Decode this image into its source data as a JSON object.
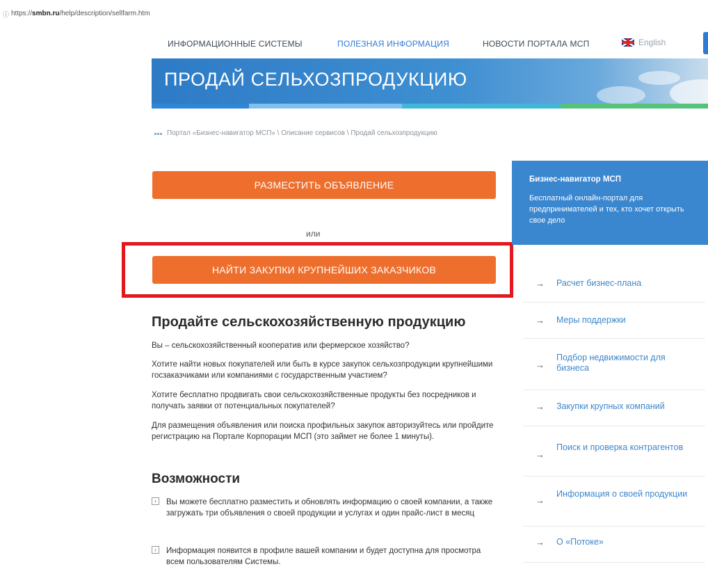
{
  "browser": {
    "url_domain": "smbn.ru",
    "url_prefix": "https://",
    "url_path": "/help/description/sellfarm.htm"
  },
  "nav": {
    "items": [
      "ИНФОРМАЦИОННЫЕ СИСТЕМЫ",
      "ПОЛЕЗНАЯ ИНФОРМАЦИЯ",
      "НОВОСТИ ПОРТАЛА МСП"
    ],
    "active_index": 1,
    "language": "English"
  },
  "banner": {
    "title": "ПРОДАЙ СЕЛЬХОЗПРОДУКЦИЮ"
  },
  "breadcrumb": "Портал «Бизнес-навигатор МСП» \\ Описание сервисов \\ Продай сельхозпродукцию",
  "actions": {
    "post_ad": "РАЗМЕСТИТЬ ОБЪЯВЛЕНИЕ",
    "or": "или",
    "find_purchases": "НАЙТИ ЗАКУПКИ КРУПНЕЙШИХ ЗАКАЗЧИКОВ"
  },
  "content": {
    "heading": "Продайте сельскохозяйственную продукцию",
    "paragraphs": [
      "Вы – сельскохозяйственный кооператив или фермерское хозяйство?",
      "Хотите найти новых покупателей или быть в курсе закупок сельхозпродукции крупнейшими госзаказчиками или компаниями с государственным участием?",
      "Хотите бесплатно продвигать свои сельскохозяйственные продукты без посредников и получать заявки от потенциальных покупателей?",
      "Для размещения объявления или поиска профильных закупок авторизуйтесь или пройдите регистрацию на Портале Корпорации МСП (это займет не более 1 минуты)."
    ],
    "features_heading": "Возможности",
    "features": [
      "Вы можете бесплатно разместить и обновлять информацию о своей компании, а также загружать три объявления о своей продукции и услугах и один прайс-лист в месяц",
      "Информация появится в профиле вашей компании и будет доступна для просмотра всем пользователям Системы."
    ]
  },
  "sidebar": {
    "info_title": "Бизнес-навигатор МСП",
    "info_text": "Бесплатный онлайн-портал для предпринимателей и тех, кто хочет открыть свое дело",
    "menu": [
      "Расчет бизнес-плана",
      "Меры поддержки",
      "Подбор недвижимости для бизнеса",
      "Закупки крупных компаний",
      "Поиск и проверка контрагентов",
      "Информация о своей продукции",
      "О «Потоке»"
    ]
  },
  "colors": {
    "accent_blue": "#2e7bd3",
    "button_orange": "#ee6f2d",
    "highlight_red": "#e4161e",
    "info_box_blue": "#3a86cf"
  },
  "icons": [
    "info-icon",
    "flag-uk-icon",
    "breadcrumb-dots-icon",
    "arrow-right-icon",
    "bullet-arrow-icon"
  ]
}
